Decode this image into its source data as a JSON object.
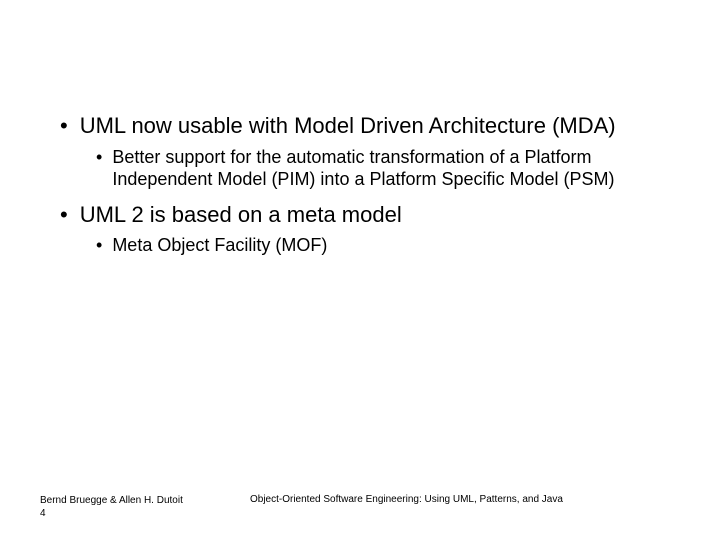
{
  "bullets": [
    {
      "text": "UML now usable with Model Driven Architecture (MDA)",
      "children": [
        "Better support for the automatic transformation of a Platform Independent Model (PIM) into a Platform Specific Model (PSM)"
      ]
    },
    {
      "text": "UML 2 is based on a meta model",
      "children": [
        "Meta Object Facility (MOF)"
      ]
    }
  ],
  "footer": {
    "authors": "Bernd Bruegge & Allen H. Dutoit",
    "page": "4",
    "book": "Object-Oriented Software Engineering: Using UML, Patterns, and Java"
  }
}
